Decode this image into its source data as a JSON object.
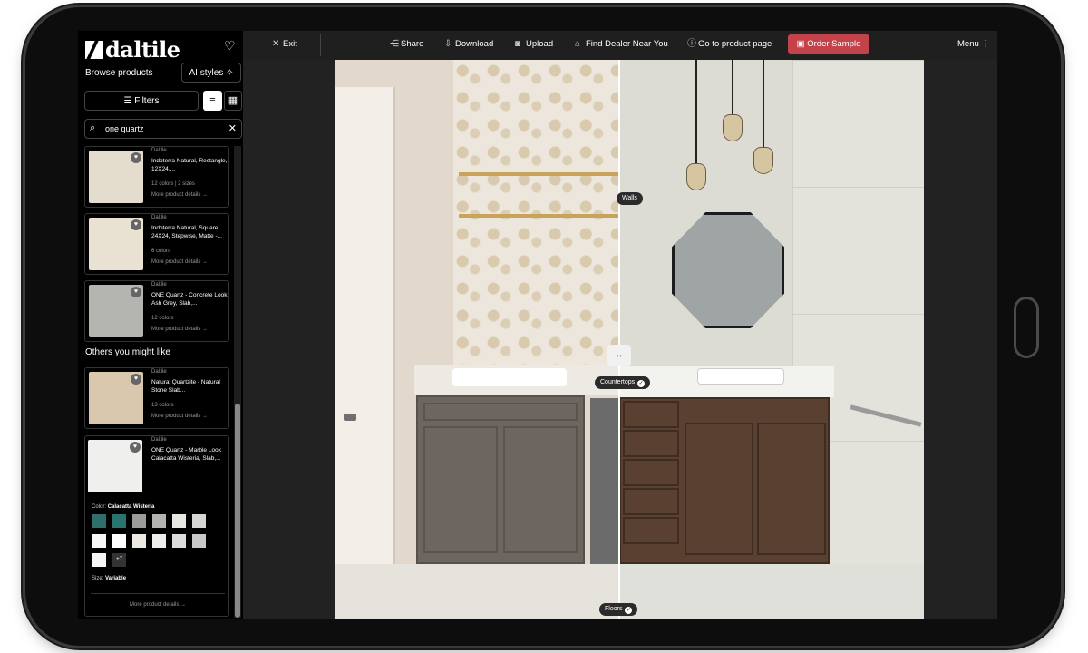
{
  "brand": {
    "logo_text": "daltile"
  },
  "sidebar": {
    "browse_label": "Browse products",
    "ai_styles_label": "AI styles",
    "filters_label": "Filters",
    "search": {
      "value": "one quartz",
      "placeholder": "Search"
    },
    "results": [
      {
        "brand": "Daltile",
        "name": "Indoterra Natural, Rectangle, 12X24,...",
        "meta": "12 colors | 2 sizes",
        "link": "More product details →",
        "thumb_color": "#e4dccd"
      },
      {
        "brand": "Daltile",
        "name": "Indoterra Natural, Square, 24X24, Stepwise, Matte -...",
        "meta": "6 colors",
        "link": "More product details →",
        "thumb_color": "#e9e2d2"
      },
      {
        "brand": "Daltile",
        "name": "ONE Quartz - Concrete Look Ash Grey, Slab,...",
        "meta": "12 colors",
        "link": "More product details →",
        "thumb_color": "#b4b4b0"
      }
    ],
    "others_label": "Others you might like",
    "others": [
      {
        "brand": "Daltile",
        "name": "Natural Quartzite - Natural Stone Slab...",
        "meta": "13 colors",
        "link": "More product details →",
        "thumb_color": "#d9c8ad"
      }
    ],
    "featured": {
      "brand": "Daltile",
      "name": "ONE Quartz - Marble Look Calacatta Wisteria, Slab,...",
      "color_prefix": "Color:",
      "color_name": "Calacatta Wisteria",
      "swatches": [
        "#2f6e6a",
        "#2a7470",
        "#9b9b98",
        "#b3b3b0",
        "#e6e6e2",
        "#d6d6d2",
        "#f7f7f5",
        "#ffffff",
        "#ece8e2",
        "#f0eeec",
        "#dcdcdc",
        "#c8c8c6",
        "#f4f4f2"
      ],
      "more_swatches": "+7",
      "size_prefix": "Size:",
      "size_value": "Variable",
      "link": "More product details →",
      "thumb_color": "#efefed"
    }
  },
  "toolbar": {
    "exit": "Exit",
    "share": "Share",
    "download": "Download",
    "upload": "Upload",
    "find_dealer": "Find Dealer Near You",
    "product_page": "Go to product page",
    "order_sample": "Order Sample",
    "menu": "Menu"
  },
  "canvas": {
    "labels": {
      "walls": "Walls",
      "countertops": "Countertops",
      "floors": "Floors"
    },
    "split_handle": "↔"
  },
  "colors": {
    "accent": "#c4434a",
    "sidebar_bg": "#000000",
    "toolbar_bg": "#1f1f1f"
  }
}
